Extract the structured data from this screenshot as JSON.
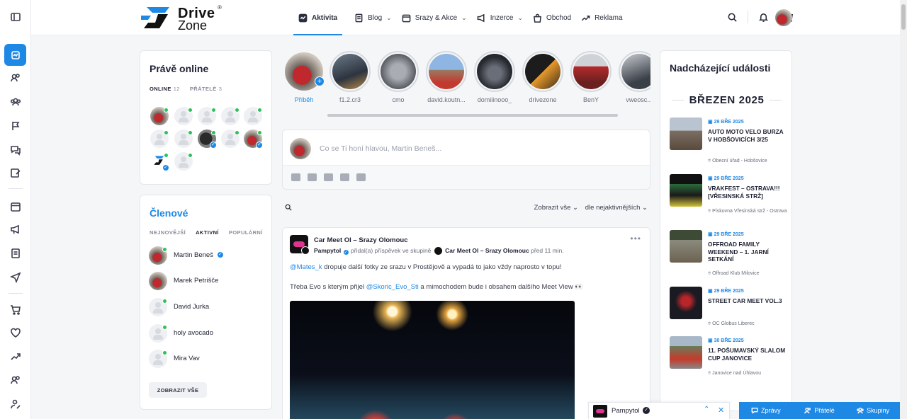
{
  "brand": {
    "line1": "Drive",
    "line2": "Zone",
    "reg": "®"
  },
  "nav": [
    {
      "label": "Aktivita",
      "icon": "activity-icon",
      "active": true,
      "dropdown": false
    },
    {
      "label": "Blog",
      "icon": "document-icon",
      "active": false,
      "dropdown": true
    },
    {
      "label": "Srazy & Akce",
      "icon": "calendar-icon",
      "active": false,
      "dropdown": true
    },
    {
      "label": "Inzerce",
      "icon": "megaphone-icon",
      "active": false,
      "dropdown": true
    },
    {
      "label": "Obchod",
      "icon": "shopping-bag-icon",
      "active": false,
      "dropdown": false
    },
    {
      "label": "Reklama",
      "icon": "trending-up-icon",
      "active": false,
      "dropdown": false
    }
  ],
  "online": {
    "title": "Právě online",
    "tabs": [
      {
        "label": "ONLINE",
        "count": "12"
      },
      {
        "label": "PŘÁTELÉ",
        "count": "3"
      }
    ]
  },
  "members": {
    "title": "Členové",
    "tabs": [
      "NEJNOVĚJŠÍ",
      "AKTIVNÍ",
      "POPULÁRNÍ"
    ],
    "list": [
      "Martin Beneš",
      "Marek Petrišče",
      "David Jurka",
      "holy avocado",
      "Mira Vav"
    ],
    "show_all": "ZOBRAZIT VŠE"
  },
  "stories": [
    "Příběh",
    "f1.2.cr3",
    "cmo",
    "david.koutn...",
    "domiiinooo_",
    "drivezone",
    "BenY",
    "vweosc..."
  ],
  "composer": {
    "placeholder": "Co se Ti honí hlavou, Martin Beneš..."
  },
  "filters": {
    "show": "Zobrazit vše",
    "sort": "dle nejaktivnějších"
  },
  "post": {
    "group": "Car Meet Ol – Srazy Olomouc",
    "author": "Pampytol",
    "action": "přidal(a) příspěvek ve skupině",
    "group_ref": "Car Meet Ol – Srazy Olomouc",
    "time": "před 11 min.",
    "mention1": "@Mates_k",
    "text1": " dropuje další fotky ze srazu v Prostějově a vypadá to jako vždy naprosto v topu!",
    "text2a": "Třeba Evo s kterým přijel ",
    "mention2": "@Skoric_Evo_Sti",
    "text2b": " a mimochodem bude i obsahem dalšího Meet View 👀"
  },
  "events": {
    "title": "Nadcházející události",
    "month": "BŘEZEN 2025",
    "items": [
      {
        "date": "29 BŘE 2025",
        "title": "AUTO MOTO VELO BURZA V HOBŠOVICÍCH 3/25",
        "location": "Obecní úřad - Hobšovice"
      },
      {
        "date": "29 BŘE 2025",
        "title": "VRAKFEST – OSTRAVA!!! [VŘESINSKÁ STRŽ]",
        "location": "Pískovna Vřesinská strž - Ostrava"
      },
      {
        "date": "29 BŘE 2025",
        "title": "OFFROAD FAMILY WEEKEND – 1. JARNÍ SETKÁNÍ",
        "location": "Offroad Klub Milovice"
      },
      {
        "date": "29 BŘE 2025",
        "title": "STREET CAR MEET VOL.3",
        "location": "OC Globus Liberec"
      },
      {
        "date": "30 BŘE 2025",
        "title": "11. POŠUMAVSKÝ SLALOM CUP JANOVICE",
        "location": "Janovice nad Úhlavou"
      }
    ]
  },
  "chat": {
    "name": "Pampytol"
  },
  "dock": [
    "Zprávy",
    "Přátelé",
    "Skupiny"
  ],
  "colors": {
    "accent": "#1e88e5",
    "online": "#2fbf5d"
  }
}
